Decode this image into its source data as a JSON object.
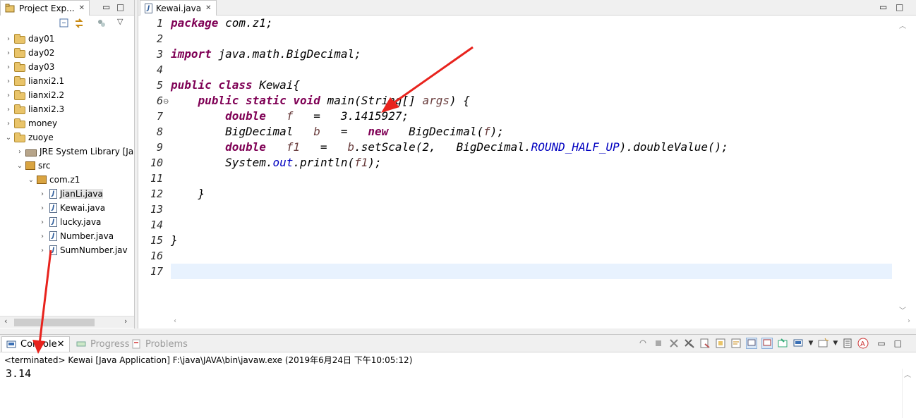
{
  "explorer": {
    "tab_label": "Project Exp...",
    "items": [
      {
        "label": "day01",
        "indent": 0,
        "expanded": false,
        "kind": "project"
      },
      {
        "label": "day02",
        "indent": 0,
        "expanded": false,
        "kind": "project"
      },
      {
        "label": "day03",
        "indent": 0,
        "expanded": false,
        "kind": "project"
      },
      {
        "label": "lianxi2.1",
        "indent": 0,
        "expanded": false,
        "kind": "project"
      },
      {
        "label": "lianxi2.2",
        "indent": 0,
        "expanded": false,
        "kind": "project"
      },
      {
        "label": "lianxi2.3",
        "indent": 0,
        "expanded": false,
        "kind": "project"
      },
      {
        "label": "money",
        "indent": 0,
        "expanded": false,
        "kind": "project"
      },
      {
        "label": "zuoye",
        "indent": 0,
        "expanded": true,
        "kind": "project"
      },
      {
        "label": "JRE System Library [Ja",
        "indent": 1,
        "expanded": false,
        "kind": "library"
      },
      {
        "label": "src",
        "indent": 1,
        "expanded": true,
        "kind": "srcfolder"
      },
      {
        "label": "com.z1",
        "indent": 2,
        "expanded": true,
        "kind": "package"
      },
      {
        "label": "JianLi.java",
        "indent": 3,
        "expanded": false,
        "kind": "file",
        "selected": true
      },
      {
        "label": "Kewai.java",
        "indent": 3,
        "expanded": false,
        "kind": "file"
      },
      {
        "label": "lucky.java",
        "indent": 3,
        "expanded": false,
        "kind": "file"
      },
      {
        "label": "Number.java",
        "indent": 3,
        "expanded": false,
        "kind": "file"
      },
      {
        "label": "SumNumber.jav",
        "indent": 3,
        "expanded": false,
        "kind": "file"
      }
    ]
  },
  "editor": {
    "tab_label": "Kewai.java",
    "line_numbers": [
      "1",
      "2",
      "3",
      "4",
      "5",
      "6",
      "7",
      "8",
      "9",
      "10",
      "11",
      "12",
      "13",
      "14",
      "15",
      "16",
      "17"
    ],
    "current_line": 17,
    "lines": [
      {
        "n": "1",
        "text": "package com.z1;"
      },
      {
        "n": "2",
        "text": ""
      },
      {
        "n": "3",
        "text": "import java.math.BigDecimal;"
      },
      {
        "n": "4",
        "text": ""
      },
      {
        "n": "5",
        "text": "public class Kewai{"
      },
      {
        "n": "6",
        "text": "    public static void main(String[] args) {"
      },
      {
        "n": "7",
        "text": "        double   f   =   3.1415927;"
      },
      {
        "n": "8",
        "text": "        BigDecimal   b   =   new   BigDecimal(f);"
      },
      {
        "n": "9",
        "text": "        double   f1   =   b.setScale(2,   BigDecimal.ROUND_HALF_UP).doubleValue();"
      },
      {
        "n": "10",
        "text": "        System.out.println(f1);"
      },
      {
        "n": "11",
        "text": ""
      },
      {
        "n": "12",
        "text": "    }"
      },
      {
        "n": "13",
        "text": ""
      },
      {
        "n": "14",
        "text": ""
      },
      {
        "n": "15",
        "text": "}"
      },
      {
        "n": "16",
        "text": ""
      },
      {
        "n": "17",
        "text": ""
      }
    ],
    "fold_marker": "⊖"
  },
  "console": {
    "tabs": [
      {
        "label": "Console",
        "active": true
      },
      {
        "label": "Progress",
        "active": false
      },
      {
        "label": "Problems",
        "active": false
      }
    ],
    "status": "<terminated> Kewai [Java Application] F:\\java\\JAVA\\bin\\javaw.exe (2019年6月24日 下午10:05:12)",
    "output": "3.14"
  },
  "colors": {
    "keyword": "#7f0055",
    "static_field": "#0000c0",
    "variable": "#6a3e3e",
    "change_bar": "#5fa8a5",
    "annotation_arrow": "#e8231d",
    "current_line": "#e8f2fe"
  },
  "icons": {
    "explorer_tab": "project-explorer-icon",
    "editor_tab": "java-file-icon",
    "console_tab": "console-icon"
  }
}
